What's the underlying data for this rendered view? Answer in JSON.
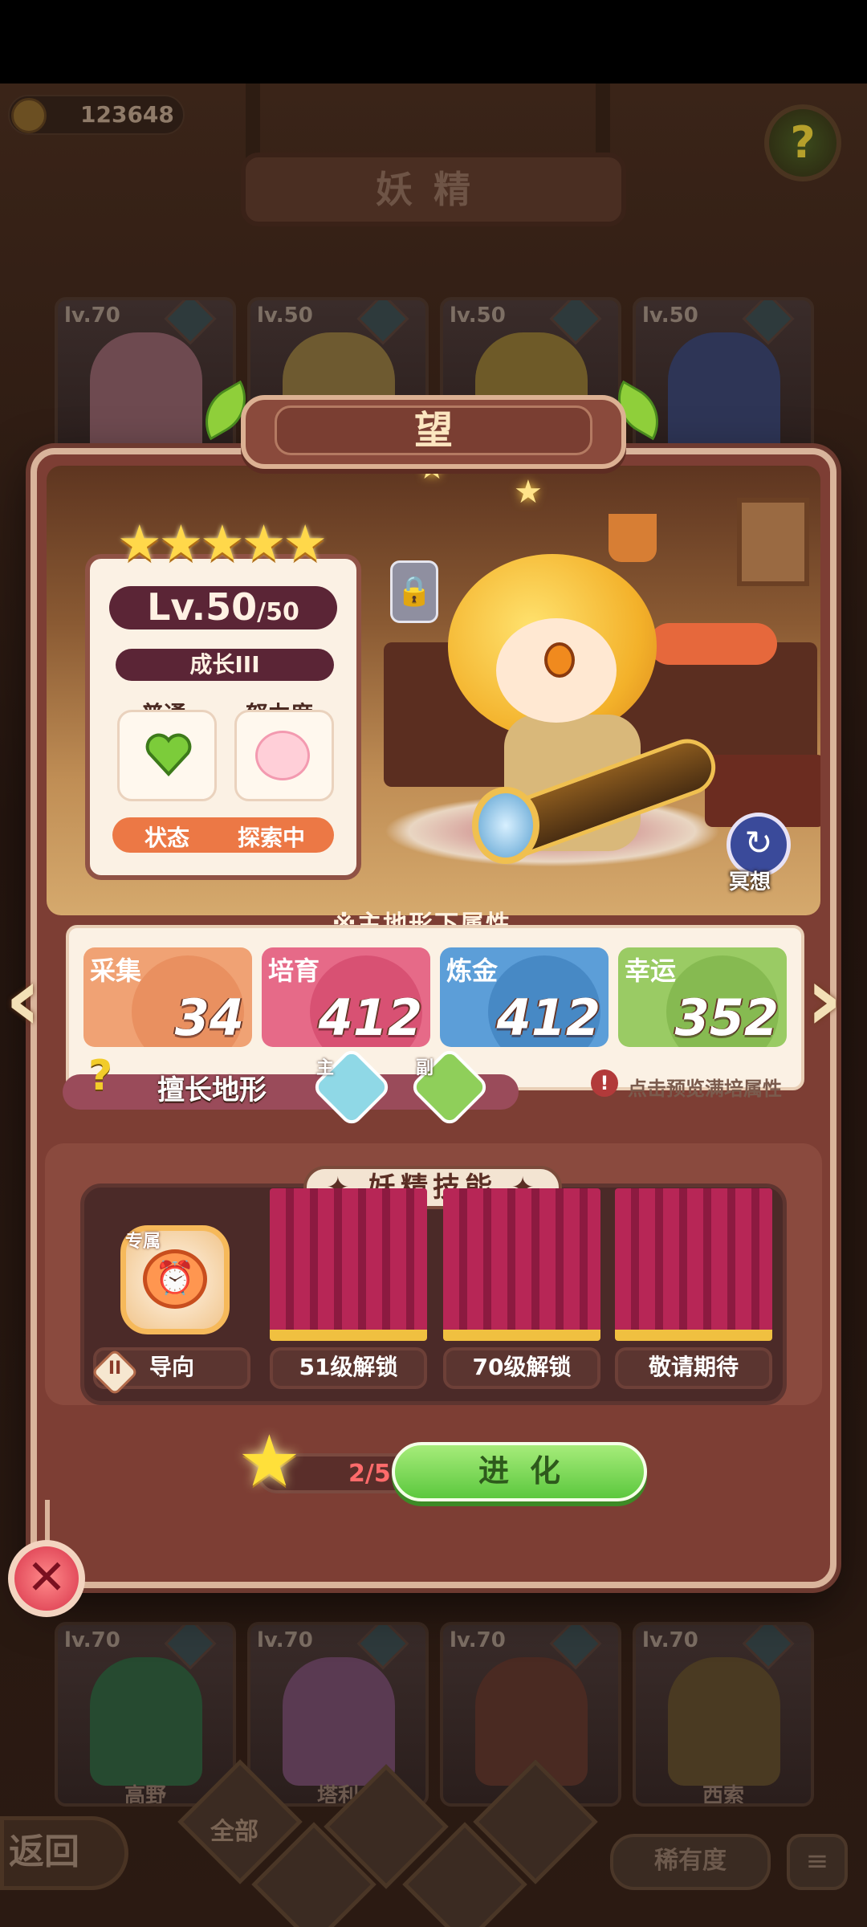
{
  "top_bar": {
    "coins": "123648",
    "title": "妖精",
    "help": "?"
  },
  "background_cards_top": [
    {
      "level": "lv.70"
    },
    {
      "level": "lv.50"
    },
    {
      "level": "lv.50"
    },
    {
      "level": "lv.50"
    }
  ],
  "background_cards_bottom": [
    {
      "level": "lv.70",
      "name": "高野"
    },
    {
      "level": "lv.70",
      "name": "塔利"
    },
    {
      "level": "lv.70",
      "name": ""
    },
    {
      "level": "lv.70",
      "name": "西索"
    }
  ],
  "bottom_nav": {
    "back": "返回",
    "filter_all": "全部",
    "rarity": "稀有度",
    "sort": "≡"
  },
  "fairy": {
    "name": "望",
    "stars": "★★★★★",
    "level_current": "Lv.50",
    "level_max": "/50",
    "growth": "成长III",
    "attr1_label": "普通",
    "attr2_label": "努力度",
    "status_label": "状态",
    "status_value": "探索中",
    "meditate_label": "冥想"
  },
  "terrain": {
    "title": "※主地形下属性",
    "stats": [
      {
        "name": "采集",
        "value": "34",
        "color": "#f0a274"
      },
      {
        "name": "培育",
        "value": "412",
        "color": "#e66a88"
      },
      {
        "name": "炼金",
        "value": "412",
        "color": "#5c9ed8"
      },
      {
        "name": "幸运",
        "value": "352",
        "color": "#9acb64"
      }
    ],
    "specialty_label": "擅长地形",
    "main_tag": "主",
    "sub_tag": "副",
    "preview_hint": "点击预览满培属性"
  },
  "skills": {
    "title": "✦ 妖精技能 ✦",
    "exclusive_tag": "专属",
    "slots": [
      {
        "label": "导向",
        "badge": "II"
      },
      {
        "label": "51级解锁"
      },
      {
        "label": "70级解锁"
      },
      {
        "label": "敬请期待"
      }
    ]
  },
  "evolve": {
    "progress": "2/5",
    "button": "进化"
  },
  "colors": {
    "panel": "#7d3e34",
    "accent_green": "#5cc83e",
    "level_bar": "#5b2536",
    "status_orange": "#ec7845"
  }
}
